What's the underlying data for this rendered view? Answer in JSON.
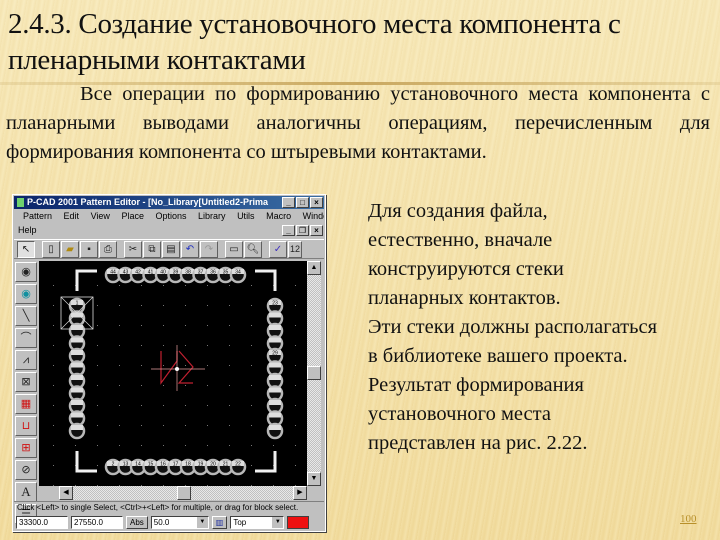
{
  "slide": {
    "title": "2.4.3. Создание установочного места компонента с пленарными контактами",
    "intro_paragraph": "Все операции по формированию установочного места компонента с планарными выводами аналогичны операциям, перечисленным для формирования компонента со штыревыми контактами.",
    "side_text": [
      "Для создания файла,",
      "естественно, вначале",
      "конструируются стеки",
      "планарных контактов.",
      "Эти стеки должны располагаться",
      "в библиотеке вашего проекта.",
      "Результат формирования",
      "установочного места",
      "представлен на рис. 2.22."
    ],
    "page_number": "100"
  },
  "pcad_window": {
    "title": "P-CAD 2001 Pattern Editor - [No_Library[Untitled2-Prima",
    "title_buttons": [
      "_",
      "□",
      "×"
    ],
    "menu": [
      "Pattern",
      "Edit",
      "View",
      "Place",
      "Options",
      "Library",
      "Utils",
      "Macro",
      "Window"
    ],
    "menu_help": "Help",
    "mdi_buttons": [
      "_",
      "❐",
      "×"
    ],
    "toolbar_icons": [
      "select",
      "new",
      "open",
      "save",
      "print",
      "cut",
      "copy",
      "paste",
      "undo",
      "redo",
      "measure",
      "zoom",
      "check"
    ],
    "toolbar_value": "12",
    "left_tools": [
      "place-pad",
      "place-via",
      "line",
      "arc",
      "polygon",
      "ref-point",
      "copper-pour",
      "keepout",
      "cutout",
      "no-entry",
      "text",
      "attribute"
    ],
    "top_pads": [
      "44",
      "43",
      "42",
      "41",
      "40",
      "39",
      "38",
      "37",
      "36",
      "35",
      "34"
    ],
    "bottom_pads": [
      "2",
      "13",
      "14",
      "15",
      "16",
      "17",
      "18",
      "19",
      "20",
      "21",
      "22"
    ],
    "right_pad_labels": [
      "23",
      "29"
    ],
    "left_pad_label": "1",
    "status_message": "Click <Left> to single Select, <Ctrl>+<Left> for multiple, or drag for block select.",
    "coord_x": "33300.0",
    "coord_y": "27550.0",
    "abs_button": "Abs",
    "grid_value": "50.0",
    "layer_value": "Top",
    "layer_color": "#ee1010"
  }
}
